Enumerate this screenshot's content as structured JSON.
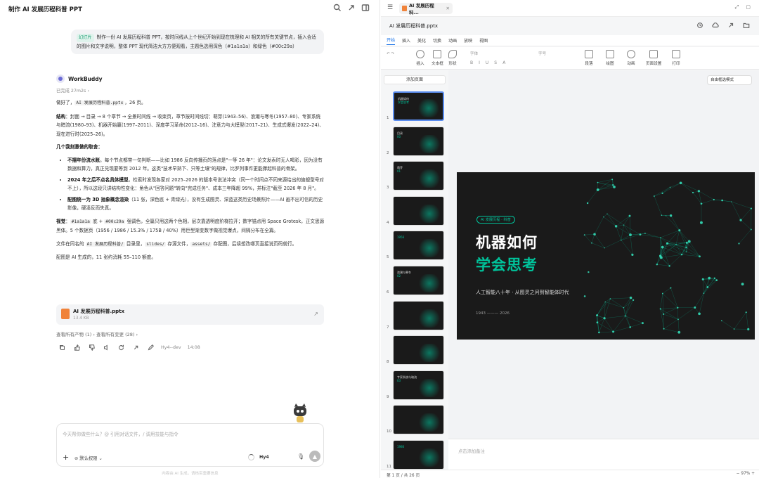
{
  "left": {
    "title": "制作 AI 发展历程科普 PPT",
    "user_msg_tag": "幻灯片",
    "user_msg": "制作一份 AI 发展历程科普 PPT，按时间线从上个世纪开始到现在梳理和 AI 相关的所有关键节点，插入合适的图片和文字说明，整体 PPT 现代简洁大方方便观看，主题色选用深色（#1a1a1a）和绿色（#00c29a）",
    "bot_name": "WorkBuddy",
    "done": "已完成 27m2s ›",
    "p1a": "做好了，",
    "p1code": "AI 发展历程科普.pptx",
    "p1b": "，26 页。",
    "p2label": "结构",
    "p2": "：封面 → 目录 → 8 个章节 → 全景时间线 → 收束页，章节按时间线切：萌芽(1943–56)、浪潮与寒冬(1957–80)、专家系统与暗流(1980–93)、机器开始赢(1997–2011)、深度学习革命(2012–16)、注意力与大模型(2017–21)、生成式爆发(2022–24)、现在进行时(2025–26)。",
    "p3label": "几个我刻意做的取舍",
    "b1label": "不摆年份流水账",
    "b1": "。每个节点都带一句判断——比如 1986 反向传播页的落点是\"一等 26 年\"：论文发表时无人喝彩，因为没有数据和算力，真正兑现要等到 2012 年。这类\"技术早熟下、只等土壤\"的规律，比罗列事件更能撑起科普的骨架。",
    "b2label": "2024 年之后不点名具体模型",
    "b2": "。检索时发现各家对 2025–2026 的版本号说法冲突（同一个时间点不同来源给出的旗舰型号对不上），所以这段只讲结构性变化：角色从\"回答问题\"转向\"完成任务\"、成本三年降超 99%，并标注\"截至 2026 年 8 月\"。",
    "b3label": "配图统一为 3D 抽象概念渲染",
    "b3": "（11 张，深色底 + 青绿光），没有生成图灵、深蓝这类历史场景照片——AI 画不出可信的历史影像，硬凑反而失真。",
    "p4label": "视觉",
    "p4a": "：",
    "p4code1": "#1a1a1a",
    "p4b": " 底 + ",
    "p4code2": "#00c29a",
    "p4c": " 强调色，全篇只用这两个色相，层次靠透明度阶梯拉开；数字锚点用 Space Grotesk，正文思源黑体。5 个数据页（1956 / 1986 / 15.3% / 175B / 40%）用巨型渐变数字做视觉爆点，间隔分布在全篇。",
    "p5a": "文件在同名的 ",
    "p5code1": "AI 发展历程科普/",
    "p5b": " 目录里，",
    "p5code2": "slides/",
    "p5c": " 存源文件，",
    "p5code3": "assets/",
    "p5d": " 存配图，后续想改哪页直接说页码就行。",
    "p6": "配图是 AI 生成的，11 张约消耗 55–110 额度。",
    "file_name": "AI 发展历程科普.pptx",
    "file_size": "13.4 KB",
    "links": "查看所有产物 (1) ›    查看所有变更 (28) ›",
    "author": "Hy4--dev",
    "time": "14:08",
    "input_placeholder": "今天帮你做些什么？@ 引用对话文件，/ 调用技能与指令",
    "permission": "默认权限 ⌄",
    "model": "Hy4",
    "footer": "内容由 AI 生成，请核实重要信息"
  },
  "right": {
    "tab_title": "AI 发展历程科...",
    "file_name": "AI 发展历程科普.pptx",
    "menus": [
      "开始",
      "插入",
      "美化",
      "切换",
      "动画",
      "放映",
      "视图"
    ],
    "toolbar": {
      "insert": "插入",
      "textbox": "文本框",
      "shape": "形状",
      "font": "字体",
      "size": "字号",
      "paragraph": "段落",
      "draw": "绘图",
      "animation": "动画",
      "page_setup": "页面设置",
      "print": "打印"
    },
    "add_page": "添加页面",
    "focus_mode": "自由框选模式",
    "thumbs": [
      {
        "n": "1",
        "t": "机器如何",
        "g": "学会思考"
      },
      {
        "n": "2",
        "t": "目录",
        "g": "00"
      },
      {
        "n": "3",
        "t": "萌芽",
        "g": "01"
      },
      {
        "n": "4",
        "t": "",
        "g": ""
      },
      {
        "n": "5",
        "t": "",
        "g": "1956"
      },
      {
        "n": "6",
        "t": "浪潮与寒冬",
        "g": "02"
      },
      {
        "n": "7",
        "t": "",
        "g": ""
      },
      {
        "n": "8",
        "t": "",
        "g": ""
      },
      {
        "n": "9",
        "t": "专家系统与暗流",
        "g": "03"
      },
      {
        "n": "10",
        "t": "",
        "g": ""
      },
      {
        "n": "11",
        "t": "",
        "g": "1986"
      }
    ],
    "slide": {
      "badge": "AI 发展历程 · 科普",
      "title1": "机器如何",
      "title2": "学会思考",
      "subtitle": "人工智能八十年 · 从图灵之问到智能体时代",
      "years": "1943 ——— 2026"
    },
    "notes_placeholder": "点击添加备注",
    "status_page": "第 1 页 / 共 26 页",
    "zoom": "97%",
    "colors": {
      "bg": "#1a1a1a",
      "accent": "#00c29a"
    }
  }
}
